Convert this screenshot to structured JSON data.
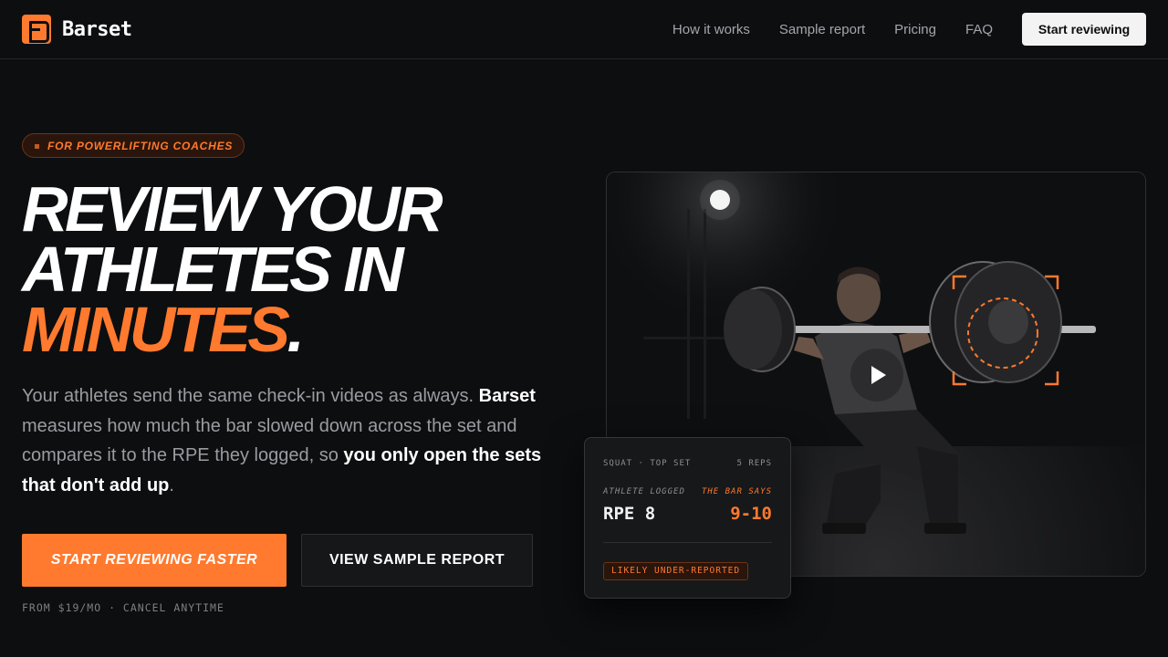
{
  "brand": {
    "name": "Barset",
    "accent": "#ff7a2e"
  },
  "nav": {
    "links": [
      "How it works",
      "Sample report",
      "Pricing",
      "FAQ"
    ],
    "cta": "Start reviewing"
  },
  "hero": {
    "badge": "FOR POWERLIFTING COACHES",
    "headline_line1": "REVIEW YOUR",
    "headline_line2": "ATHLETES IN",
    "headline_accent": "MINUTES",
    "headline_period": ".",
    "lede_1": "Your athletes send the same check-in videos as always.",
    "lede_brand": "Barset",
    "lede_2": "measures how much the bar slowed down across the set and compares it to the RPE they logged, so",
    "lede_emphasis": "you only open the sets that don't add up",
    "lede_end": ".",
    "primary_cta": "START REVIEWING FASTER",
    "secondary_cta": "VIEW SAMPLE REPORT",
    "fineprint": "FROM $19/MO · CANCEL ANYTIME"
  },
  "video": {
    "icon": "play-icon"
  },
  "card": {
    "lift": "SQUAT · TOP SET",
    "reps": "5 REPS",
    "athlete_label": "ATHLETE LOGGED",
    "athlete_value": "RPE 8",
    "bar_label": "THE BAR SAYS",
    "bar_value": "9-10",
    "flag": "LIKELY UNDER-REPORTED"
  }
}
